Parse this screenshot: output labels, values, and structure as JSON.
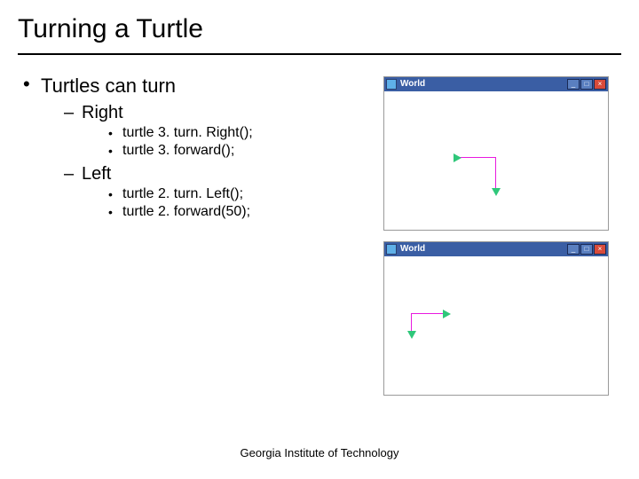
{
  "title": "Turning a Turtle",
  "bullets": {
    "main": "Turtles can turn",
    "right": {
      "label": "Right",
      "code1": "turtle 3. turn. Right();",
      "code2": "turtle 3. forward();"
    },
    "left": {
      "label": "Left",
      "code1": "turtle 2. turn. Left();",
      "code2": "turtle 2. forward(50);"
    }
  },
  "footer": "Georgia Institute of Technology",
  "window": {
    "title": "World",
    "min": "_",
    "max": "□",
    "close": "×"
  }
}
